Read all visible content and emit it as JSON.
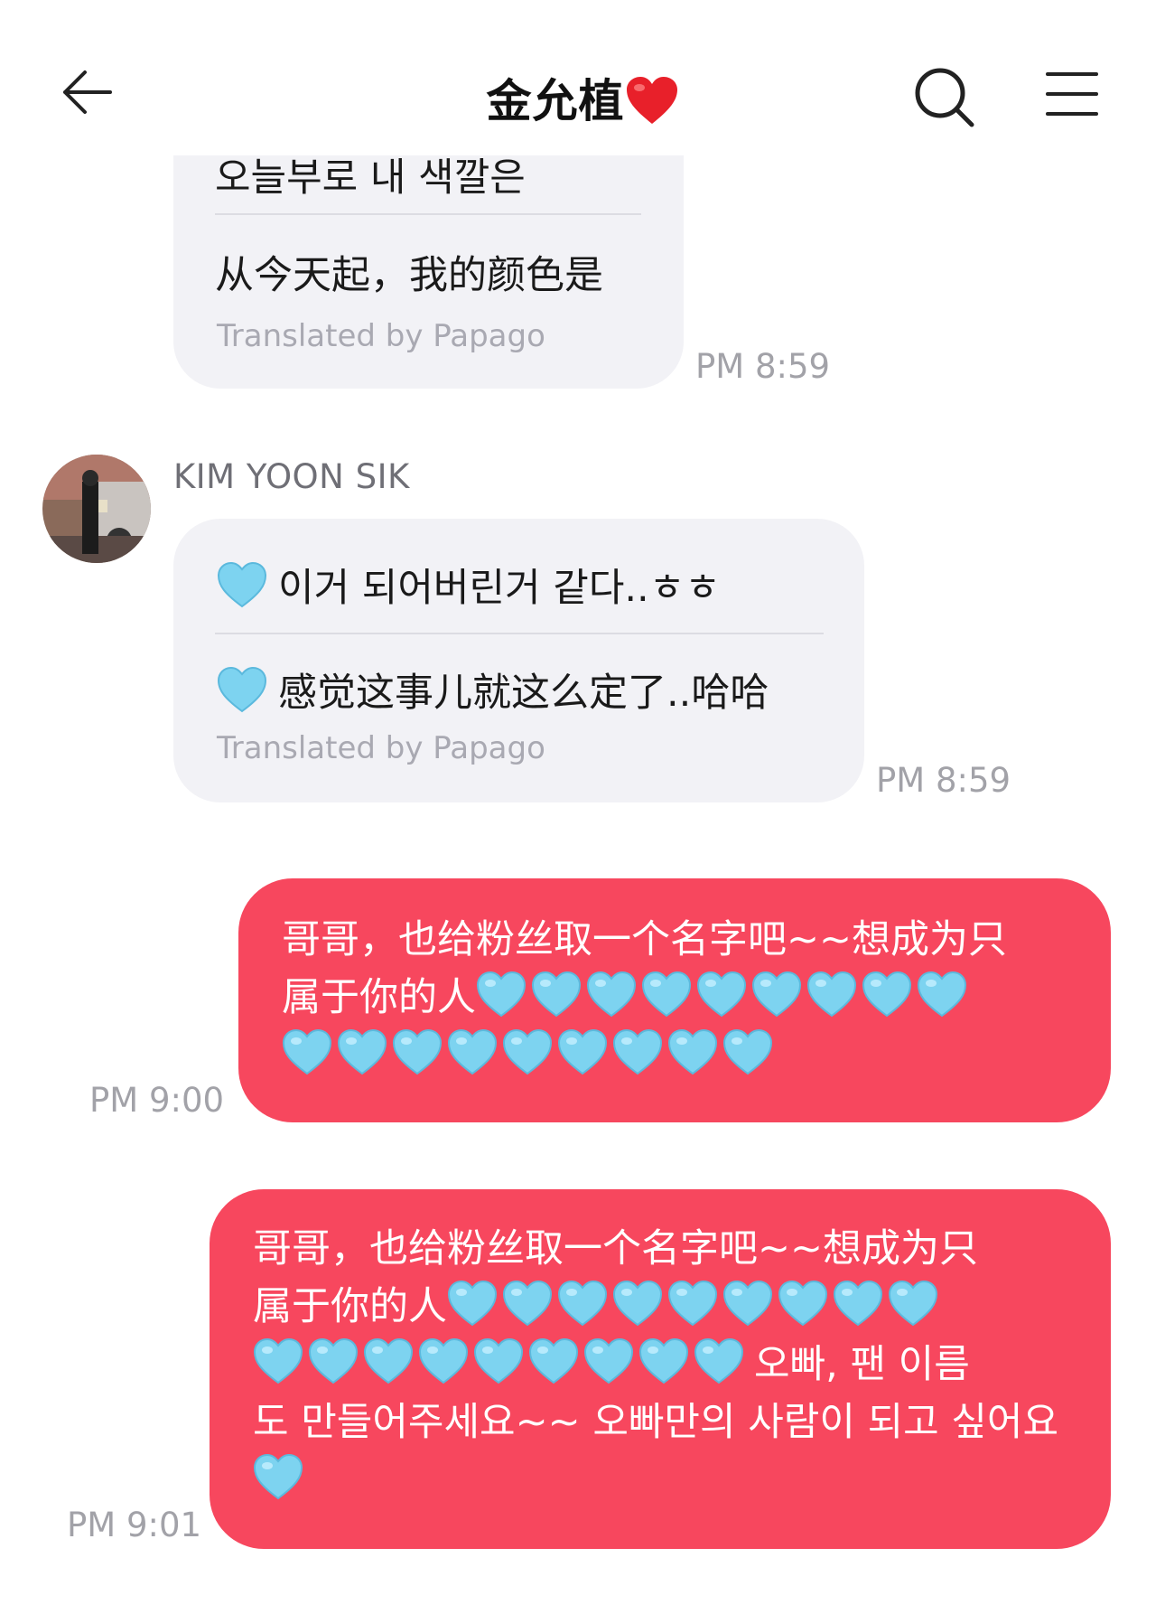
{
  "header": {
    "title": "金允植",
    "title_emoji": "red-heart",
    "back_icon": "arrow-left-icon",
    "search_icon": "search-icon",
    "menu_icon": "menu-icon"
  },
  "messages": [
    {
      "direction": "incoming",
      "original": "오늘부로 내 색깔은",
      "translation": "从今天起，我的颜色是",
      "translated_by": "Translated by Papago",
      "time": "PM 8:59"
    },
    {
      "direction": "incoming",
      "sender": "KIM YOON SIK",
      "original": "이거 되어버린거 같다..ㅎㅎ",
      "translation": "感觉这事儿就这么定了..哈哈",
      "translated_by": "Translated by Papago",
      "time": "PM 8:59",
      "emoji": "light-blue-heart"
    },
    {
      "direction": "outgoing",
      "line1": "哥哥，也给粉丝取一个名字吧~~想成为只",
      "line2": "属于你的人",
      "hearts_line2": 9,
      "hearts_line3": 9,
      "time": "PM 9:00"
    },
    {
      "direction": "outgoing",
      "line1": "哥哥，也给粉丝取一个名字吧~~想成为只",
      "line2": "属于你的人",
      "hearts_line2": 9,
      "hearts_line3": 9,
      "line3_text": "오빠, 팬 이름",
      "line4": "도 만들어주세요~~ 오빠만의 사람이 되고 싶어요",
      "hearts_line5": 1,
      "time": "PM 9:01"
    }
  ],
  "colors": {
    "outgoing_bubble": "#f7475e",
    "incoming_bubble": "#f2f2f6",
    "heart": "#7dd3f0"
  }
}
